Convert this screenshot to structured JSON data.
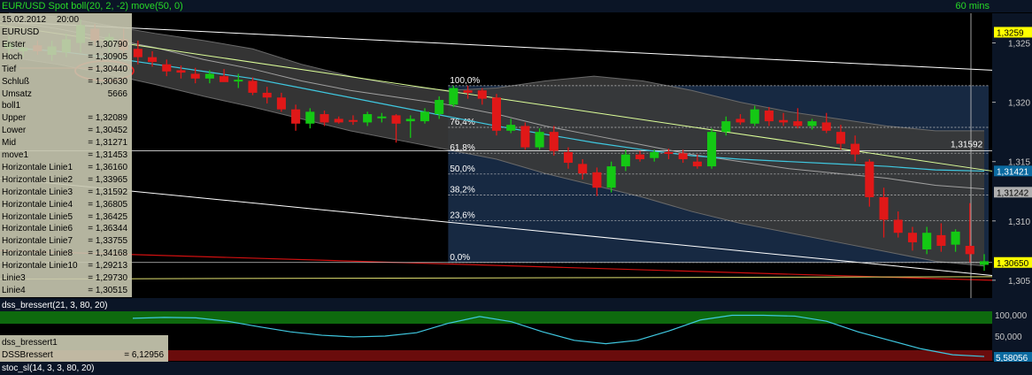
{
  "header": {
    "title": "EUR/USD Spot boll(20, 2, -2) move(50, 0)",
    "interval": "60 mins"
  },
  "info_panel": {
    "date": "15.02.2012",
    "time": "20:00",
    "rows": [
      {
        "label": "EURUSD",
        "value": ""
      },
      {
        "label": "Erster",
        "value": "= 1,30790"
      },
      {
        "label": "Hoch",
        "value": "= 1,30905"
      },
      {
        "label": "Tief",
        "value": "= 1,30440"
      },
      {
        "label": "Schluß",
        "value": "= 1,30630"
      },
      {
        "label": "Umsatz",
        "value": "5666"
      },
      {
        "label": "boll1",
        "value": ""
      },
      {
        "label": "Upper",
        "value": "= 1,32089"
      },
      {
        "label": "Lower",
        "value": "= 1,30452"
      },
      {
        "label": "Mid",
        "value": "= 1,31271"
      },
      {
        "label": "move1",
        "value": "= 1,31453"
      },
      {
        "label": "Horizontale Linie1",
        "value": "= 1,36160"
      },
      {
        "label": "Horizontale Linie2",
        "value": "= 1,33965"
      },
      {
        "label": "Horizontale Linie3",
        "value": "= 1,31592"
      },
      {
        "label": "Horizontale Linie4",
        "value": "= 1,36805"
      },
      {
        "label": "Horizontale Linie5",
        "value": "= 1,36425"
      },
      {
        "label": "Horizontale Linie6",
        "value": "= 1,36344"
      },
      {
        "label": "Horizontale Linie7",
        "value": "= 1,33755"
      },
      {
        "label": "Horizontale Linie8",
        "value": "= 1,34168"
      },
      {
        "label": "Horizontale Linie10",
        "value": "= 1,29213"
      },
      {
        "label": "Linie3",
        "value": "= 1,29730"
      },
      {
        "label": "Linie4",
        "value": "= 1,30515"
      }
    ]
  },
  "subpanel": {
    "title": "dss_bressert(21, 3, 80, 20)",
    "box_title": "dss_bressert1",
    "box_label": "DSSBressert",
    "box_value": "= 6,12956",
    "bottom_title": "stoc_sl(14, 3, 3, 80, 20)"
  },
  "colors": {
    "up": "#14c814",
    "down": "#e01818",
    "band": "#3a3a3a",
    "fib": "#2a4a78",
    "accent": "#ffff00"
  },
  "chart_data": {
    "type": "candlestick",
    "y_axis": {
      "ticks": [
        "1,325",
        "1,320",
        "1,315",
        "1,310",
        "1,305"
      ],
      "range": [
        1.3035,
        1.3275
      ]
    },
    "price_tags": [
      {
        "label": "1,3259",
        "value": 1.3259,
        "bg": "#ffff00",
        "fg": "#000000"
      },
      {
        "label": "1,31421",
        "value": 1.31421,
        "bg": "#0a6aa0",
        "fg": "#ffffff"
      },
      {
        "label": "1,31242",
        "value": 1.31242,
        "bg": "#b0b0b0",
        "fg": "#000000"
      },
      {
        "label": "1,30650",
        "value": 1.3065,
        "bg": "#ffff00",
        "fg": "#000000"
      }
    ],
    "fibonacci": {
      "high": 1.3214,
      "low": 1.3065,
      "levels": [
        {
          "label": "100,0%",
          "ratio": 1.0
        },
        {
          "label": "76,4%",
          "ratio": 0.764
        },
        {
          "label": "61,8%",
          "ratio": 0.618
        },
        {
          "label": "50,0%",
          "ratio": 0.5
        },
        {
          "label": "38,2%",
          "ratio": 0.382
        },
        {
          "label": "23,6%",
          "ratio": 0.236
        },
        {
          "label": "0,0%",
          "ratio": 0.0
        }
      ]
    },
    "hline_label": "1,31592",
    "hline_value": 1.31592,
    "candles": [
      {
        "o": 1.3245,
        "h": 1.3256,
        "l": 1.324,
        "c": 1.325
      },
      {
        "o": 1.3243,
        "h": 1.325,
        "l": 1.3238,
        "c": 1.3246
      },
      {
        "o": 1.3248,
        "h": 1.3252,
        "l": 1.324,
        "c": 1.3243
      },
      {
        "o": 1.324,
        "h": 1.3252,
        "l": 1.3235,
        "c": 1.3247
      },
      {
        "o": 1.3242,
        "h": 1.3258,
        "l": 1.3238,
        "c": 1.3253
      },
      {
        "o": 1.325,
        "h": 1.327,
        "l": 1.3242,
        "c": 1.3265
      },
      {
        "o": 1.3262,
        "h": 1.3266,
        "l": 1.3248,
        "c": 1.3252
      },
      {
        "o": 1.3252,
        "h": 1.3258,
        "l": 1.3242,
        "c": 1.3255
      },
      {
        "o": 1.3253,
        "h": 1.3262,
        "l": 1.324,
        "c": 1.3244
      },
      {
        "o": 1.3245,
        "h": 1.3252,
        "l": 1.3232,
        "c": 1.3238
      },
      {
        "o": 1.3238,
        "h": 1.3243,
        "l": 1.323,
        "c": 1.3234
      },
      {
        "o": 1.3232,
        "h": 1.3236,
        "l": 1.3222,
        "c": 1.3226
      },
      {
        "o": 1.3227,
        "h": 1.3231,
        "l": 1.322,
        "c": 1.3225
      },
      {
        "o": 1.3224,
        "h": 1.3229,
        "l": 1.3216,
        "c": 1.322
      },
      {
        "o": 1.322,
        "h": 1.3227,
        "l": 1.3216,
        "c": 1.3224
      },
      {
        "o": 1.3222,
        "h": 1.3228,
        "l": 1.3218,
        "c": 1.3217
      },
      {
        "o": 1.3219,
        "h": 1.3224,
        "l": 1.3212,
        "c": 1.3219
      },
      {
        "o": 1.3218,
        "h": 1.3221,
        "l": 1.3206,
        "c": 1.3208
      },
      {
        "o": 1.3208,
        "h": 1.3213,
        "l": 1.3199,
        "c": 1.3204
      },
      {
        "o": 1.3204,
        "h": 1.3208,
        "l": 1.3192,
        "c": 1.3194
      },
      {
        "o": 1.3194,
        "h": 1.3198,
        "l": 1.3176,
        "c": 1.3182
      },
      {
        "o": 1.3182,
        "h": 1.3195,
        "l": 1.3178,
        "c": 1.3192
      },
      {
        "o": 1.319,
        "h": 1.3193,
        "l": 1.318,
        "c": 1.3183
      },
      {
        "o": 1.3186,
        "h": 1.3188,
        "l": 1.3182,
        "c": 1.3183
      },
      {
        "o": 1.3185,
        "h": 1.3189,
        "l": 1.3181,
        "c": 1.3184
      },
      {
        "o": 1.3183,
        "h": 1.3192,
        "l": 1.318,
        "c": 1.319
      },
      {
        "o": 1.3187,
        "h": 1.3191,
        "l": 1.3183,
        "c": 1.3188
      },
      {
        "o": 1.3189,
        "h": 1.319,
        "l": 1.3166,
        "c": 1.3182
      },
      {
        "o": 1.3184,
        "h": 1.3189,
        "l": 1.317,
        "c": 1.3186
      },
      {
        "o": 1.3184,
        "h": 1.3195,
        "l": 1.3182,
        "c": 1.3192
      },
      {
        "o": 1.319,
        "h": 1.3205,
        "l": 1.3186,
        "c": 1.3202
      },
      {
        "o": 1.3198,
        "h": 1.3214,
        "l": 1.3196,
        "c": 1.3212
      },
      {
        "o": 1.321,
        "h": 1.3214,
        "l": 1.3203,
        "c": 1.3208
      },
      {
        "o": 1.321,
        "h": 1.3212,
        "l": 1.3198,
        "c": 1.3203
      },
      {
        "o": 1.3204,
        "h": 1.3207,
        "l": 1.3172,
        "c": 1.3176
      },
      {
        "o": 1.3176,
        "h": 1.3186,
        "l": 1.3174,
        "c": 1.3181
      },
      {
        "o": 1.318,
        "h": 1.3183,
        "l": 1.316,
        "c": 1.3162
      },
      {
        "o": 1.3162,
        "h": 1.3178,
        "l": 1.316,
        "c": 1.3175
      },
      {
        "o": 1.3175,
        "h": 1.318,
        "l": 1.3155,
        "c": 1.3159
      },
      {
        "o": 1.3158,
        "h": 1.3162,
        "l": 1.3144,
        "c": 1.3149
      },
      {
        "o": 1.3148,
        "h": 1.3152,
        "l": 1.3135,
        "c": 1.314
      },
      {
        "o": 1.3141,
        "h": 1.3145,
        "l": 1.3121,
        "c": 1.3128
      },
      {
        "o": 1.3128,
        "h": 1.315,
        "l": 1.3124,
        "c": 1.3146
      },
      {
        "o": 1.3146,
        "h": 1.316,
        "l": 1.3142,
        "c": 1.3156
      },
      {
        "o": 1.3156,
        "h": 1.3159,
        "l": 1.315,
        "c": 1.3152
      },
      {
        "o": 1.3153,
        "h": 1.316,
        "l": 1.315,
        "c": 1.3158
      },
      {
        "o": 1.3158,
        "h": 1.3161,
        "l": 1.3152,
        "c": 1.3157
      },
      {
        "o": 1.3157,
        "h": 1.316,
        "l": 1.3149,
        "c": 1.3152
      },
      {
        "o": 1.315,
        "h": 1.3156,
        "l": 1.3144,
        "c": 1.3146
      },
      {
        "o": 1.3146,
        "h": 1.3178,
        "l": 1.3144,
        "c": 1.3175
      },
      {
        "o": 1.3175,
        "h": 1.3188,
        "l": 1.3172,
        "c": 1.3184
      },
      {
        "o": 1.3186,
        "h": 1.319,
        "l": 1.3181,
        "c": 1.3183
      },
      {
        "o": 1.3182,
        "h": 1.3197,
        "l": 1.318,
        "c": 1.3194
      },
      {
        "o": 1.3193,
        "h": 1.3196,
        "l": 1.318,
        "c": 1.3184
      },
      {
        "o": 1.3185,
        "h": 1.3191,
        "l": 1.318,
        "c": 1.3183
      },
      {
        "o": 1.3184,
        "h": 1.3195,
        "l": 1.3178,
        "c": 1.318
      },
      {
        "o": 1.318,
        "h": 1.3186,
        "l": 1.3177,
        "c": 1.3184
      },
      {
        "o": 1.3183,
        "h": 1.3191,
        "l": 1.3174,
        "c": 1.3176
      },
      {
        "o": 1.3175,
        "h": 1.3181,
        "l": 1.316,
        "c": 1.3165
      },
      {
        "o": 1.3165,
        "h": 1.3172,
        "l": 1.315,
        "c": 1.3156
      },
      {
        "o": 1.315,
        "h": 1.3152,
        "l": 1.3112,
        "c": 1.312
      },
      {
        "o": 1.312,
        "h": 1.3128,
        "l": 1.3086,
        "c": 1.3101
      },
      {
        "o": 1.3101,
        "h": 1.3108,
        "l": 1.3086,
        "c": 1.309
      },
      {
        "o": 1.309,
        "h": 1.3095,
        "l": 1.3075,
        "c": 1.3082
      },
      {
        "o": 1.3076,
        "h": 1.3095,
        "l": 1.3072,
        "c": 1.309
      },
      {
        "o": 1.3088,
        "h": 1.3098,
        "l": 1.3074,
        "c": 1.3079
      },
      {
        "o": 1.308,
        "h": 1.3093,
        "l": 1.3074,
        "c": 1.3091
      },
      {
        "o": 1.3079,
        "h": 1.3115,
        "l": 1.3065,
        "c": 1.3072
      },
      {
        "o": 1.3063,
        "h": 1.3072,
        "l": 1.3058,
        "c": 1.3066
      }
    ],
    "boll_upper": [
      1.3275,
      1.3272,
      1.3265,
      1.3258,
      1.3252,
      1.3245,
      1.3232,
      1.3222,
      1.3214,
      1.321,
      1.3212,
      1.3218,
      1.3222,
      1.3218,
      1.321,
      1.32,
      1.3192,
      1.3186,
      1.318,
      1.3176,
      1.3176
    ],
    "boll_lower": [
      1.3238,
      1.3232,
      1.3224,
      1.3215,
      1.3205,
      1.3196,
      1.3186,
      1.3176,
      1.3168,
      1.316,
      1.3152,
      1.314,
      1.313,
      1.312,
      1.3108,
      1.3098,
      1.309,
      1.3082,
      1.3074,
      1.3066,
      1.3062
    ],
    "sma": [
      1.3268,
      1.3262,
      1.3254,
      1.3246,
      1.3236,
      1.3228,
      1.3218,
      1.321,
      1.3204,
      1.3198,
      1.319,
      1.318,
      1.3172,
      1.3164,
      1.3156,
      1.315,
      1.3144,
      1.314,
      1.3136,
      1.313,
      1.3127
    ],
    "move": [
      1.3246,
      1.3243,
      1.3238,
      1.3232,
      1.3226,
      1.322,
      1.3212,
      1.3204,
      1.3196,
      1.3188,
      1.318,
      1.3173,
      1.3166,
      1.316,
      1.3155,
      1.3152,
      1.315,
      1.3148,
      1.3146,
      1.3143,
      1.3142
    ],
    "dss": {
      "ticks": [
        "100,000",
        "50,000"
      ],
      "last": "5,58056",
      "values": [
        92,
        94,
        93,
        85,
        72,
        60,
        52,
        48,
        50,
        58,
        80,
        96,
        84,
        60,
        40,
        32,
        40,
        62,
        88,
        99,
        99,
        97,
        85,
        60,
        40,
        20,
        6,
        2
      ]
    }
  }
}
